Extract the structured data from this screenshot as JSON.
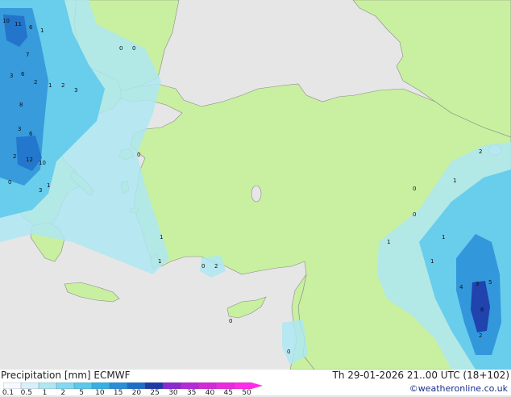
{
  "map": {
    "colors": {
      "sea": "#e6e6e6",
      "land": "#c8f0a0",
      "coast": "#8a8a8a",
      "precip_light": "#aee6f2",
      "precip_mid": "#5cc8ec",
      "precip_heavy": "#2a8ed8",
      "precip_max": "#1e3aa8"
    }
  },
  "precip_values": [
    "10",
    "11",
    "6",
    "7",
    "1",
    "3",
    "6",
    "2",
    "1",
    "2",
    "3",
    "8",
    "6",
    "3",
    "2",
    "12",
    "10",
    "0",
    "3",
    "1",
    "0",
    "0",
    "0",
    "1",
    "2",
    "1",
    "0",
    "0",
    "2",
    "1",
    "0",
    "1",
    "0",
    "4",
    "3",
    "6",
    "5",
    "2",
    "1",
    "1",
    "0"
  ],
  "legend": {
    "title": "Precipitation [mm]",
    "model": "ECMWF",
    "ticks": [
      "0.1",
      "0.5",
      "1",
      "2",
      "5",
      "10",
      "15",
      "20",
      "25",
      "30",
      "35",
      "40",
      "45",
      "50"
    ],
    "colors": [
      "#f4faff",
      "#d8f0fc",
      "#aee6f2",
      "#84d8f0",
      "#5cc8ec",
      "#38b0e4",
      "#2a8ed8",
      "#1e6ec8",
      "#1e3aa8",
      "#8a2ad0",
      "#b42ad8",
      "#d22ad8",
      "#ea2ae0",
      "#ff2aea"
    ]
  },
  "valid_time": "Th 29-01-2026 21..00 UTC (18+102)",
  "credit": "©weatheronline.co.uk"
}
